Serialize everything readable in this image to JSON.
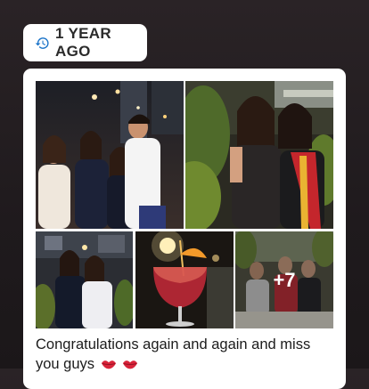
{
  "memory": {
    "label": "1 YEAR AGO",
    "icon": "history-clock-icon"
  },
  "post": {
    "photos": [
      {
        "name": "group-photo-four-friends"
      },
      {
        "name": "two-friends-photo"
      },
      {
        "name": "two-friends-night-photo"
      },
      {
        "name": "cocktail-photo"
      },
      {
        "name": "group-dinner-photo"
      }
    ],
    "more_count": "+7",
    "caption": "Congratulations again and again and miss you guys",
    "caption_emoji": "kiss-lips-icon"
  },
  "colors": {
    "badge_bg": "#ffffff",
    "badge_text": "#2b2b2b",
    "accent_icon": "#1a73c8",
    "emoji": "#d9243a"
  }
}
